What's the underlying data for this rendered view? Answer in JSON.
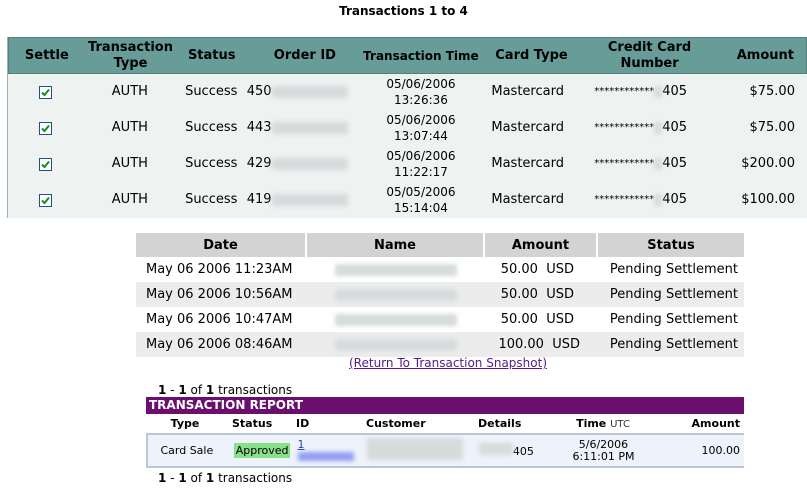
{
  "section1": {
    "title": "Transactions 1 to 4",
    "headers": {
      "settle": "Settle",
      "type": "Transaction Type",
      "status": "Status",
      "order_id": "Order ID",
      "time": "Transaction Time",
      "card_type": "Card Type",
      "ccn": "Credit Card Number",
      "amount": "Amount"
    },
    "rows": [
      {
        "type": "AUTH",
        "status": "Success",
        "order": "450",
        "date": "05/06/2006",
        "time": "13:26:36",
        "card": "Mastercard",
        "ccn_mask": "************",
        "ccn_last": "405",
        "amount": "$75.00"
      },
      {
        "type": "AUTH",
        "status": "Success",
        "order": "443",
        "date": "05/06/2006",
        "time": "13:07:44",
        "card": "Mastercard",
        "ccn_mask": "************",
        "ccn_last": "405",
        "amount": "$75.00"
      },
      {
        "type": "AUTH",
        "status": "Success",
        "order": "429",
        "date": "05/06/2006",
        "time": "11:22:17",
        "card": "Mastercard",
        "ccn_mask": "************",
        "ccn_last": "405",
        "amount": "$200.00"
      },
      {
        "type": "AUTH",
        "status": "Success",
        "order": "419",
        "date": "05/05/2006",
        "time": "15:14:04",
        "card": "Mastercard",
        "ccn_mask": "************",
        "ccn_last": "405",
        "amount": "$100.00"
      }
    ]
  },
  "section2": {
    "headers": {
      "date": "Date",
      "name": "Name",
      "amount": "Amount",
      "status": "Status"
    },
    "rows": [
      {
        "date": "May 06 2006 11:23AM",
        "amount": "50.00",
        "currency": "USD",
        "status": "Pending Settlement"
      },
      {
        "date": "May 06 2006 10:56AM",
        "amount": "50.00",
        "currency": "USD",
        "status": "Pending Settlement"
      },
      {
        "date": "May 06 2006 10:47AM",
        "amount": "50.00",
        "currency": "USD",
        "status": "Pending Settlement"
      },
      {
        "date": "May 06 2006 08:46AM",
        "amount": "100.00",
        "currency": "USD",
        "status": "Pending Settlement"
      }
    ],
    "return_link": "(Return To Transaction Snapshot)"
  },
  "section3": {
    "count": {
      "from": "1",
      "sep": " - ",
      "to": "1",
      "of": " of ",
      "total": "1",
      "suffix": " transactions"
    },
    "report_title": "TRANSACTION REPORT",
    "headers": {
      "type": "Type",
      "status": "Status",
      "id": "ID",
      "customer": "Customer",
      "details": "Details",
      "time": "Time",
      "utc": "UTC",
      "amount": "Amount"
    },
    "row": {
      "type": "Card Sale",
      "status": "Approved",
      "id": "1",
      "details": "405",
      "date": "5/6/2006",
      "time": "6:11:01 PM",
      "amount": "100.00"
    },
    "colors": {
      "title_bg": "#6b0f6f",
      "approved_bg": "#88e08a"
    }
  },
  "colors": {
    "header_teal": "#679c98",
    "row_bg": "#eef2f1"
  }
}
